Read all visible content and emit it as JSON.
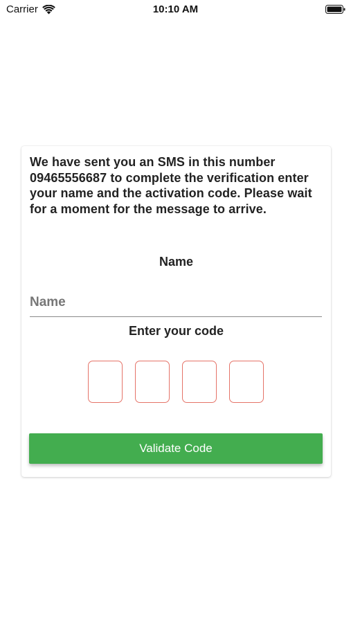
{
  "status_bar": {
    "carrier": "Carrier",
    "time": "10:10 AM",
    "wifi_icon": "wifi-icon",
    "battery_icon": "battery-full-icon"
  },
  "verification": {
    "message": "We have sent you an SMS in this number 09465556687 to complete the verification enter your name and the activation code. Please wait for a moment for the message to arrive.",
    "name_heading": "Name",
    "name_placeholder": "Name",
    "name_value": "",
    "code_heading": "Enter your code",
    "code_digits": [
      "",
      "",
      "",
      ""
    ],
    "validate_label": "Validate Code"
  },
  "colors": {
    "button_bg": "#43ad4f",
    "code_box_border": "#e57368",
    "text": "#222222"
  }
}
